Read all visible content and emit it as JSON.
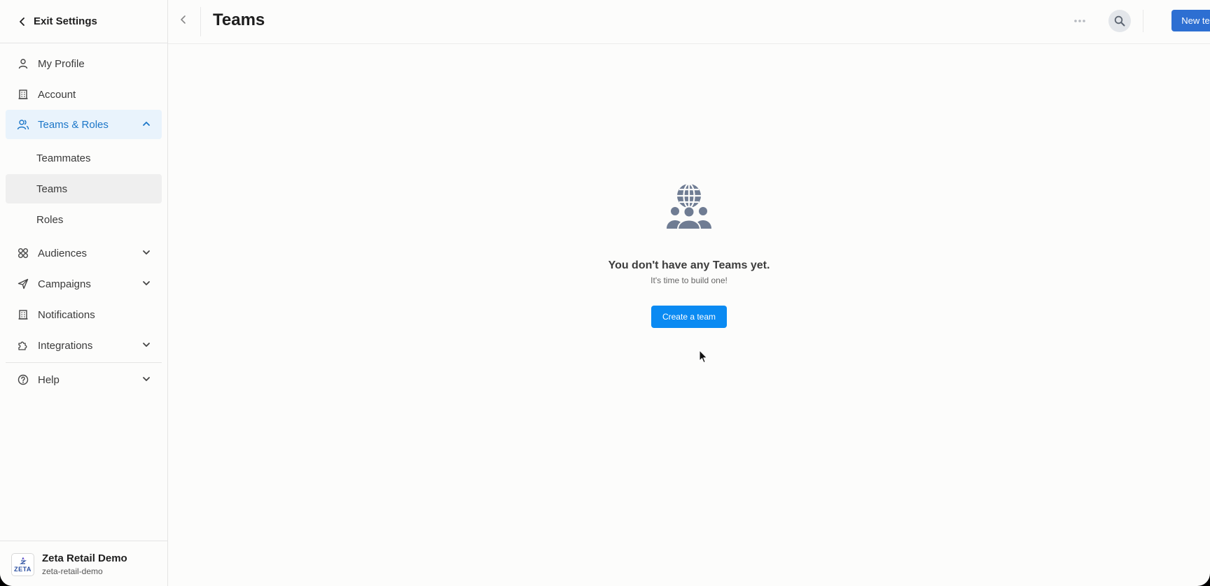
{
  "sidebar": {
    "exit_label": "Exit Settings",
    "items": [
      {
        "label": "My Profile"
      },
      {
        "label": "Account"
      },
      {
        "label": "Teams & Roles"
      },
      {
        "label": "Audiences"
      },
      {
        "label": "Campaigns"
      },
      {
        "label": "Notifications"
      },
      {
        "label": "Integrations"
      },
      {
        "label": "Help"
      }
    ],
    "sub_items": [
      {
        "label": "Teammates"
      },
      {
        "label": "Teams"
      },
      {
        "label": "Roles"
      }
    ],
    "org": {
      "name": "Zeta Retail Demo",
      "slug": "zeta-retail-demo",
      "logo_text": "ZETA"
    }
  },
  "header": {
    "title": "Teams",
    "new_button": "New team"
  },
  "empty_state": {
    "title": "You don't have any Teams yet.",
    "subtitle": "It's time to build one!",
    "button": "Create a team"
  },
  "colors": {
    "accent": "#1b76c8",
    "primary_button": "#2d6fd2",
    "create_button": "#0a8af2",
    "active_bg": "#e9f3fc"
  }
}
